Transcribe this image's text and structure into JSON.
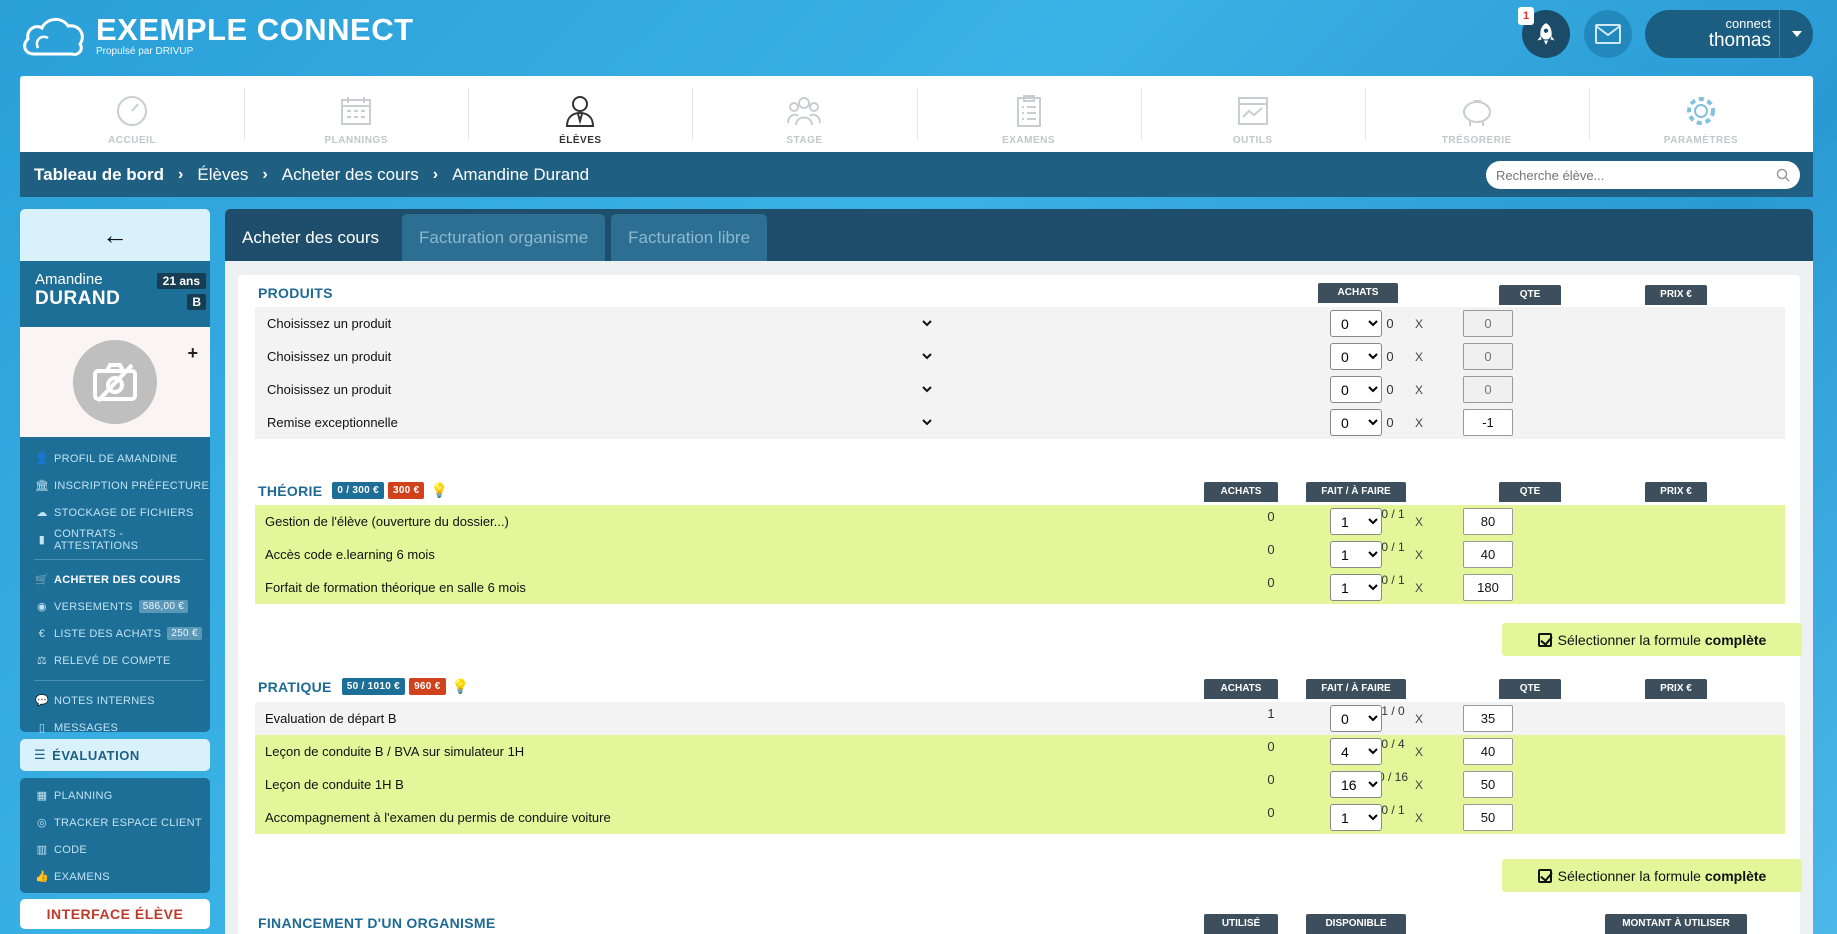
{
  "app": {
    "title": "EXEMPLE CONNECT",
    "subtitle": "Propulsé par DRIVUP",
    "notification_count": "1",
    "user_small": "connect",
    "user_name": "thomas"
  },
  "nav": [
    {
      "label": "ACCUEIL",
      "icon": "gauge-icon"
    },
    {
      "label": "PLANNINGS",
      "icon": "calendar-icon"
    },
    {
      "label": "ÉLÈVES",
      "icon": "student-icon",
      "active": true
    },
    {
      "label": "STAGE",
      "icon": "group-icon"
    },
    {
      "label": "EXAMENS",
      "icon": "clipboard-icon"
    },
    {
      "label": "OUTILS",
      "icon": "tools-icon"
    },
    {
      "label": "TRÉSORERIE",
      "icon": "piggy-bank-icon"
    },
    {
      "label": "PARAMÈTRES",
      "icon": "gear-icon"
    }
  ],
  "breadcrumb": [
    "Tableau de bord",
    "Élèves",
    "Acheter des cours",
    "Amandine Durand"
  ],
  "search": {
    "placeholder": "Recherche élève..."
  },
  "student": {
    "first_name": "Amandine",
    "last_name": "DURAND",
    "age": "21 ans",
    "license": "B"
  },
  "sidebar": {
    "menu1": [
      {
        "label": "PROFIL DE AMANDINE",
        "icon": "user-icon"
      },
      {
        "label": "INSCRIPTION PRÉFECTURE",
        "icon": "bank-icon"
      },
      {
        "label": "STOCKAGE DE FICHIERS",
        "icon": "cloud-icon"
      },
      {
        "label": "CONTRATS - ATTESTATIONS",
        "icon": "file-icon"
      }
    ],
    "menu2": [
      {
        "label": "ACHETER DES COURS",
        "icon": "cart-icon",
        "active": true
      },
      {
        "label": "VERSEMENTS",
        "icon": "piggy-icon",
        "badge": "586,00 €"
      },
      {
        "label": "LISTE DES ACHATS",
        "icon": "euro-icon",
        "badge": "250 €"
      },
      {
        "label": "RELEVÉ DE COMPTE",
        "icon": "scale-icon"
      }
    ],
    "menu3": [
      {
        "label": "NOTES INTERNES",
        "icon": "comment-icon"
      },
      {
        "label": "MESSAGES",
        "icon": "mobile-icon"
      }
    ],
    "evaluation": "ÉVALUATION",
    "menu4": [
      {
        "label": "PLANNING",
        "icon": "calendar-small-icon"
      },
      {
        "label": "TRACKER ESPACE CLIENT",
        "icon": "eye-icon"
      },
      {
        "label": "CODE",
        "icon": "book-icon"
      },
      {
        "label": "EXAMENS",
        "icon": "thumbs-up-icon"
      }
    ],
    "interface": "INTERFACE ÉLÈVE"
  },
  "tabs": [
    "Acheter des cours",
    "Facturation organisme",
    "Facturation libre"
  ],
  "headers": {
    "achats": "ACHATS",
    "qte": "QTE",
    "prix": "PRIX €",
    "fait": "FAIT / À FAIRE",
    "utilise": "UTILISÉ",
    "disponible": "DISPONIBLE",
    "montant": "MONTANT À UTILISER",
    "x": "X"
  },
  "produits": {
    "title": "PRODUITS",
    "rows": [
      {
        "label": "Choisissez un produit",
        "achats": "0",
        "qte": "0",
        "prix": "0"
      },
      {
        "label": "Choisissez un produit",
        "achats": "0",
        "qte": "0",
        "prix": "0"
      },
      {
        "label": "Choisissez un produit",
        "achats": "0",
        "qte": "0",
        "prix": "0"
      },
      {
        "label": "Remise exceptionnelle",
        "achats": "0",
        "qte": "0",
        "prix": "-1"
      }
    ]
  },
  "theorie": {
    "title": "THÉORIE",
    "badge_progress": "0 / 300 €",
    "badge_total": "300 €",
    "rows": [
      {
        "label": "Gestion de l'élève (ouverture du dossier...)",
        "achats": "0",
        "fait": "0 / 1",
        "qte": "1",
        "prix": "80"
      },
      {
        "label": "Accès code e.learning 6 mois",
        "achats": "0",
        "fait": "0 / 1",
        "qte": "1",
        "prix": "40"
      },
      {
        "label": "Forfait de formation théorique en salle 6 mois",
        "achats": "0",
        "fait": "0 / 1",
        "qte": "1",
        "prix": "180"
      }
    ],
    "formula_prefix": "Sélectionner la formule",
    "formula_strong": "complète"
  },
  "pratique": {
    "title": "PRATIQUE",
    "badge_progress": "50 / 1010 €",
    "badge_total": "960 €",
    "rows": [
      {
        "label": "Evaluation de départ B",
        "achats": "1",
        "fait": "1 / 0",
        "qte": "0",
        "prix": "35",
        "style": "gray"
      },
      {
        "label": "Leçon de conduite B / BVA sur simulateur 1H",
        "achats": "0",
        "fait": "0 / 4",
        "qte": "4",
        "prix": "40",
        "style": "green"
      },
      {
        "label": "Leçon de conduite 1H B",
        "achats": "0",
        "fait": "0 / 16",
        "qte": "16",
        "prix": "50",
        "style": "green"
      },
      {
        "label": "Accompagnement à l'examen du permis de conduire voiture",
        "achats": "0",
        "fait": "0 / 1",
        "qte": "1",
        "prix": "50",
        "style": "green"
      }
    ],
    "formula_prefix": "Sélectionner la formule",
    "formula_strong": "complète"
  },
  "financement": {
    "title": "FINANCEMENT D'UN ORGANISME"
  },
  "colors": {
    "accent": "#1e6f97",
    "dark": "#1e4e6b",
    "green_row": "#e5f59a",
    "red_badge": "#d0421b"
  }
}
